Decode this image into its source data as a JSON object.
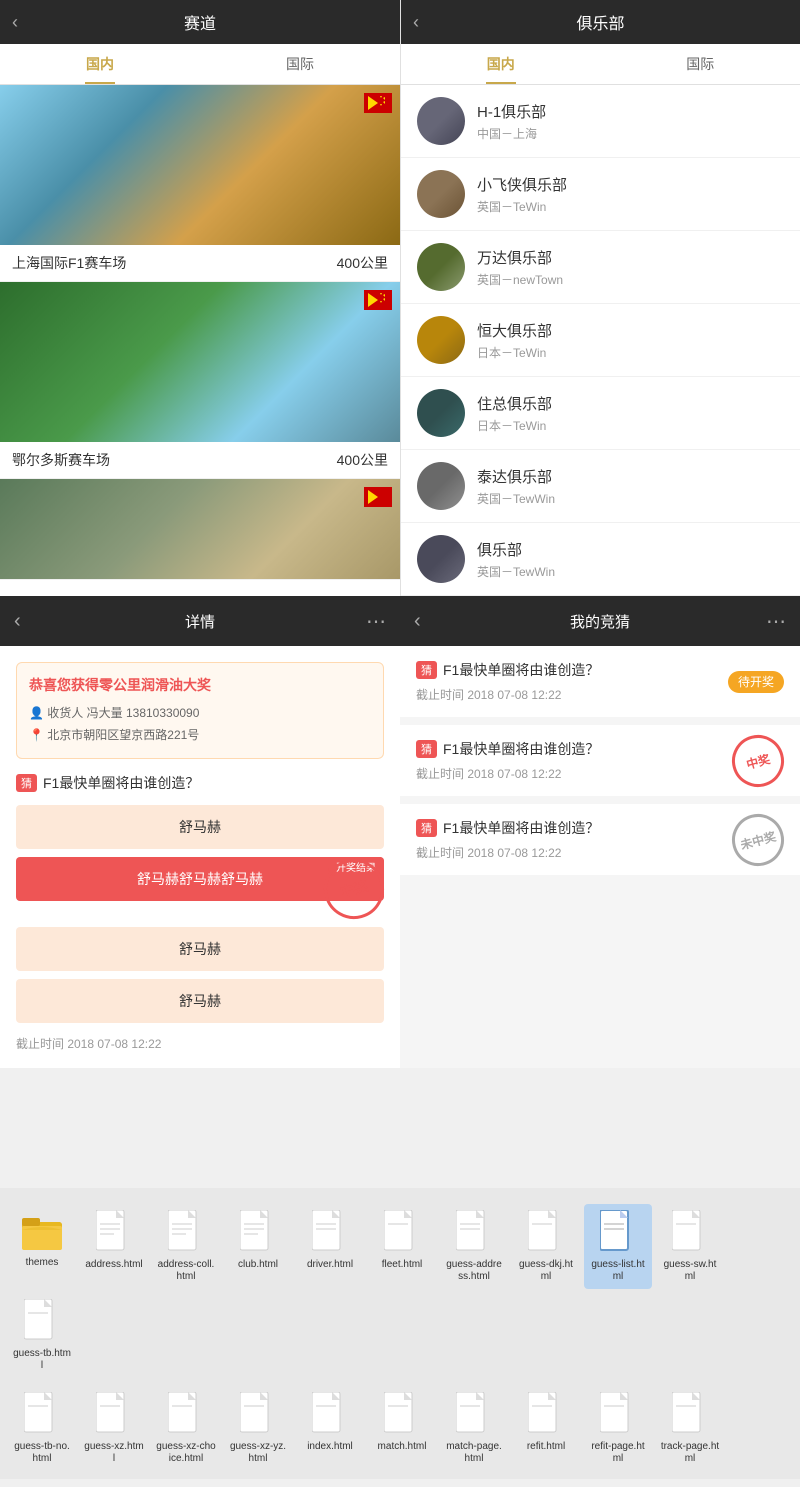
{
  "left_header": {
    "title": "赛道",
    "back": "‹"
  },
  "right_header": {
    "title": "俱乐部",
    "back": "‹"
  },
  "left_tabs": [
    {
      "label": "国内",
      "active": true
    },
    {
      "label": "国际",
      "active": false
    }
  ],
  "right_tabs": [
    {
      "label": "国内",
      "active": true
    },
    {
      "label": "国际",
      "active": false
    }
  ],
  "tracks": [
    {
      "name": "上海国际F1赛车场",
      "distance": "400公里",
      "flag": "🇨🇳"
    },
    {
      "name": "鄂尔多斯赛车场",
      "distance": "400公里",
      "flag": "🇨🇳"
    },
    {
      "name": "",
      "distance": "",
      "flag": "🇨🇳"
    }
  ],
  "clubs": [
    {
      "name": "H-1俱乐部",
      "location": "中国－上海"
    },
    {
      "name": "小飞侠俱乐部",
      "location": "英国－TeWin"
    },
    {
      "name": "万达俱乐部",
      "location": "英国－newTown"
    },
    {
      "name": "恒大俱乐部",
      "location": "日本－TeWin"
    },
    {
      "name": "住总俱乐部",
      "location": "日本－TeWin"
    },
    {
      "name": "泰达俱乐部",
      "location": "英国－TewWin"
    },
    {
      "name": "俱乐部",
      "location": "英国－TewWin"
    }
  ],
  "bottom_nav_left": {
    "back": "‹",
    "title": "详情",
    "share": "⋯"
  },
  "bottom_nav_right": {
    "back": "‹",
    "title": "我的竞猜",
    "share": "⋯"
  },
  "prize": {
    "title": "恭喜您获得零公里润滑油大奖",
    "receiver_label": "收货人",
    "receiver": "冯大量 13810330090",
    "address_label": "北京市朝阳区望京西路221号"
  },
  "question": {
    "badge": "猜",
    "title": "F1最快单圈将由谁创造？",
    "options": [
      {
        "text": "舒马赫",
        "selected": false
      },
      {
        "text": "舒马赫舒马赫舒马赫",
        "selected": true,
        "tag": "开奖结果"
      },
      {
        "text": "舒马赫",
        "selected": false
      },
      {
        "text": "舒马赫",
        "selected": false
      }
    ],
    "win_text": "中奖",
    "deadline": "截止时间 2018 07-08 12:22"
  },
  "guess_items": [
    {
      "badge": "猜",
      "title": "F1最快单圈将由谁创造？",
      "deadline": "截止时间 2018 07-08 12:22",
      "status": "pending",
      "status_text": "待开奖"
    },
    {
      "badge": "猜",
      "title": "F1最快单圈将由谁创造？",
      "deadline": "截止时间 2018 07-08 12:22",
      "status": "win",
      "status_text": "中奖"
    },
    {
      "badge": "猜",
      "title": "F1最快单圈将由谁创造？",
      "deadline": "截止时间 2018 07-08 12:22",
      "status": "lose",
      "status_text": "未中奖"
    }
  ],
  "files_row1": [
    {
      "name": "themes",
      "type": "folder",
      "selected": false
    },
    {
      "name": "address.html",
      "type": "file",
      "selected": false
    },
    {
      "name": "address-coll.html",
      "type": "file",
      "selected": false
    },
    {
      "name": "club.html",
      "type": "file",
      "selected": false
    },
    {
      "name": "driver.html",
      "type": "file",
      "selected": false
    },
    {
      "name": "fleet.html",
      "type": "file",
      "selected": false
    },
    {
      "name": "guess-address.html",
      "type": "file",
      "selected": false
    },
    {
      "name": "guess-dkj.html",
      "type": "file",
      "selected": false
    },
    {
      "name": "guess-list.html",
      "type": "file",
      "selected": true
    },
    {
      "name": "guess-sw.html",
      "type": "file",
      "selected": false
    },
    {
      "name": "guess-tb.html",
      "type": "file",
      "selected": false
    }
  ],
  "files_row2": [
    {
      "name": "guess-tb-no.html",
      "type": "file",
      "selected": false
    },
    {
      "name": "guess-xz.html",
      "type": "file",
      "selected": false
    },
    {
      "name": "guess-xz-choice.html",
      "type": "file",
      "selected": false
    },
    {
      "name": "guess-xz-yz.html",
      "type": "file",
      "selected": false
    },
    {
      "name": "index.html",
      "type": "file",
      "selected": false
    },
    {
      "name": "match.html",
      "type": "file",
      "selected": false
    },
    {
      "name": "match-page.html",
      "type": "file",
      "selected": false
    },
    {
      "name": "refit.html",
      "type": "file",
      "selected": false
    },
    {
      "name": "refit-page.html",
      "type": "file",
      "selected": false
    },
    {
      "name": "track-page.html",
      "type": "file",
      "selected": false
    }
  ]
}
